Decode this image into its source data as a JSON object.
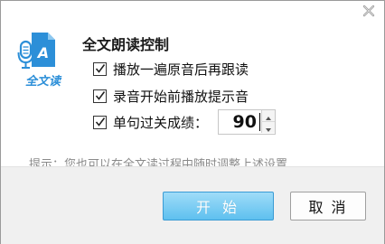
{
  "dialog": {
    "title": "全文朗读控制",
    "logo_caption": "全文读",
    "options": [
      {
        "label": "播放一遍原音后再跟读",
        "checked": true
      },
      {
        "label": "录音开始前播放提示音",
        "checked": true
      },
      {
        "label": "单句过关成绩：",
        "checked": true
      }
    ],
    "score": {
      "value": "90"
    },
    "hint": "提示：您也可以在全文读过程中随时调整上述设置",
    "buttons": {
      "start": "开 始",
      "cancel": "取 消"
    }
  },
  "colors": {
    "accent": "#5ec0ef",
    "logo": "#2c8fd8",
    "hint": "#8a8a8a"
  },
  "icons": {
    "close": "close-icon",
    "logo": "microphone-document-icon",
    "check": "check-icon",
    "spin_up": "arrow-up-icon",
    "spin_down": "arrow-down-icon"
  }
}
